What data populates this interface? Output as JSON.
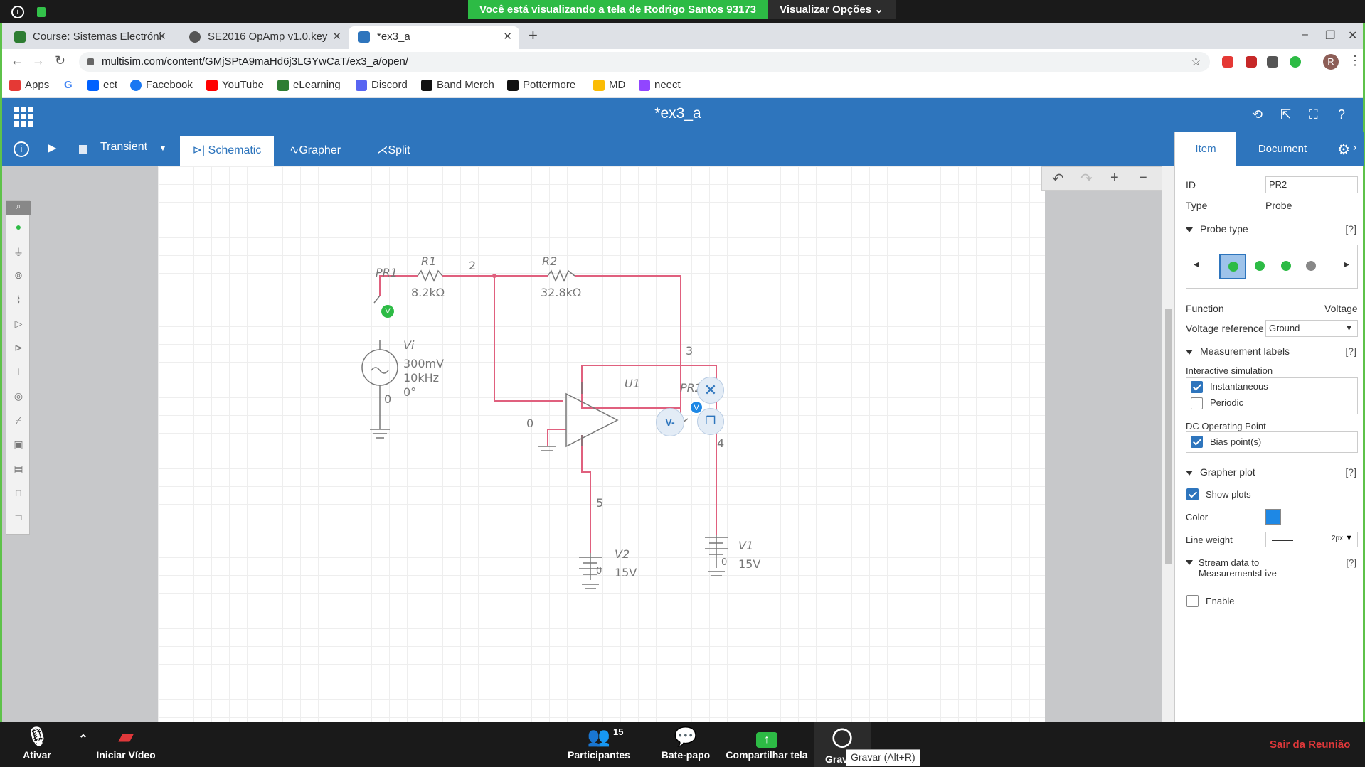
{
  "zoom_top": {
    "share_message": "Você está visualizando a tela de Rodrigo Santos 93173",
    "view_options": "Visualizar Opções ⌄"
  },
  "tabs": [
    {
      "label": "Course: Sistemas Electróni",
      "icon": "course-icon"
    },
    {
      "label": "SE2016 OpAmp v1.0.key",
      "icon": "globe-icon"
    },
    {
      "label": "*ex3_a",
      "icon": "multisim-icon"
    }
  ],
  "address": {
    "url": "multisim.com/content/GMjSPtA9maHd6j3LGYwCaT/ex3_a/open/"
  },
  "bookmarks": [
    "Apps",
    "G",
    "ect",
    "Facebook",
    "YouTube",
    "eLearning",
    "Discord",
    "Band Merch",
    "Pottermore",
    "MD",
    "neect"
  ],
  "app": {
    "title": "*ex3_a"
  },
  "toolbar": {
    "mode": "Transient",
    "tabs": [
      "Schematic",
      "Grapher",
      "Split"
    ],
    "active_tab": "Schematic"
  },
  "schematic": {
    "r1_name": "R1",
    "r1_value": "8.2kΩ",
    "r2_name": "R2",
    "r2_value": "32.8kΩ",
    "pr1": "PR1",
    "pr2": "PR2",
    "vi_name": "Vi",
    "vi_amp": "300mV",
    "vi_freq": "10kHz",
    "vi_phase": "0°",
    "u1": "U1",
    "v1_name": "V1",
    "v1_value": "15V",
    "v2_name": "V2",
    "v2_value": "15V",
    "node2": "2",
    "node3": "3",
    "node4": "4",
    "node5": "5",
    "node0a": "0",
    "node0b": "0",
    "node0c": "0",
    "node0d": "0",
    "vminus": "V-",
    "probe_v": "V"
  },
  "side": {
    "tab_item": "Item",
    "tab_document": "Document",
    "id_label": "ID",
    "id_value": "PR2",
    "type_label": "Type",
    "type_value": "Probe",
    "probe_type": "Probe type",
    "help": "[?]",
    "function_label": "Function",
    "function_value": "Voltage",
    "vref_label": "Voltage reference",
    "vref_value": "Ground",
    "meas_labels": "Measurement labels",
    "interactive": "Interactive simulation",
    "instantaneous": "Instantaneous",
    "periodic": "Periodic",
    "dcop": "DC Operating Point",
    "bias": "Bias point(s)",
    "grapher_plot": "Grapher plot",
    "show_plots": "Show plots",
    "color_label": "Color",
    "color_value": "#1e88e5",
    "lineweight_label": "Line weight",
    "lineweight_value": "2px",
    "stream_label": "Stream data to MeasurementsLive",
    "enable": "Enable",
    "checks": {
      "instantaneous": true,
      "periodic": false,
      "bias": true,
      "show_plots": true,
      "enable": false
    }
  },
  "zoom_bottom": {
    "mute": "Ativar",
    "video": "Iniciar Vídeo",
    "participants": "Participantes",
    "participants_count": "15",
    "chat": "Bate-papo",
    "share": "Compartilhar tela",
    "record": "Grav",
    "record_tooltip": "Gravar (Alt+R)",
    "leave": "Sair da Reunião"
  },
  "colors": {
    "accent": "#2e75bd",
    "wire": "#e0607e",
    "zoom_green": "#2dbb45",
    "leave_red": "#e0383a"
  }
}
